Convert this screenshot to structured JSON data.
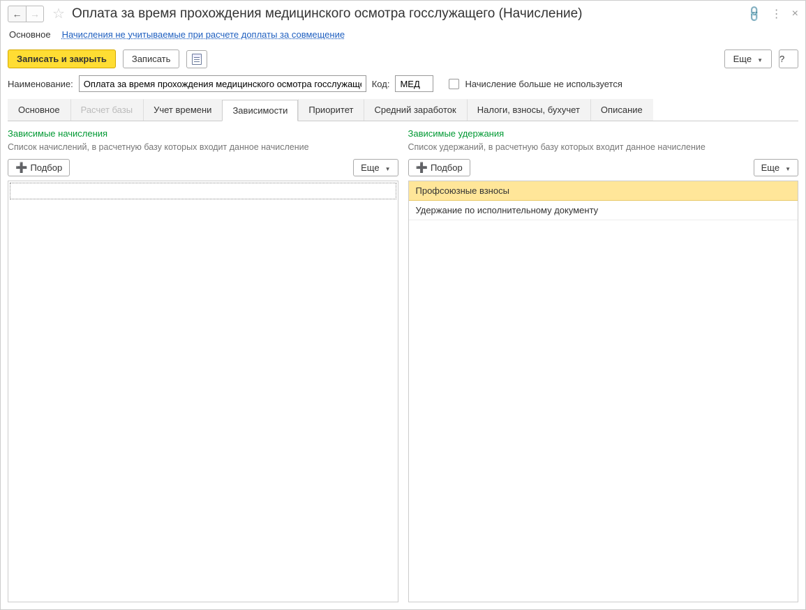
{
  "header": {
    "title": "Оплата за время прохождения медицинского осмотра госслужащего (Начисление)"
  },
  "topnav": {
    "main": "Основное",
    "link": "Начисления не учитываемые при расчете доплаты за совмещение"
  },
  "toolbar": {
    "save_close": "Записать и закрыть",
    "save": "Записать",
    "more": "Еще",
    "help": "?"
  },
  "form": {
    "name_label": "Наименование:",
    "name_value": "Оплата за время прохождения медицинского осмотра госслужаще",
    "code_label": "Код:",
    "code_value": "МЕД",
    "disused_label": "Начисление больше не используется"
  },
  "tabs": [
    {
      "label": "Основное",
      "state": "normal"
    },
    {
      "label": "Расчет базы",
      "state": "disabled"
    },
    {
      "label": "Учет времени",
      "state": "normal"
    },
    {
      "label": "Зависимости",
      "state": "active"
    },
    {
      "label": "Приоритет",
      "state": "normal"
    },
    {
      "label": "Средний заработок",
      "state": "normal"
    },
    {
      "label": "Налоги, взносы, бухучет",
      "state": "normal"
    },
    {
      "label": "Описание",
      "state": "normal"
    }
  ],
  "left_panel": {
    "title": "Зависимые начисления",
    "desc": "Список начислений, в расчетную базу которых входит данное начисление",
    "pick": "Подбор",
    "more": "Еще",
    "rows": []
  },
  "right_panel": {
    "title": "Зависимые удержания",
    "desc": "Список удержаний, в расчетную базу которых входит данное начисление",
    "pick": "Подбор",
    "more": "Еще",
    "rows": [
      {
        "text": "Профсоюзные взносы",
        "selected": true
      },
      {
        "text": "Удержание по исполнительному документу",
        "selected": false
      }
    ]
  }
}
